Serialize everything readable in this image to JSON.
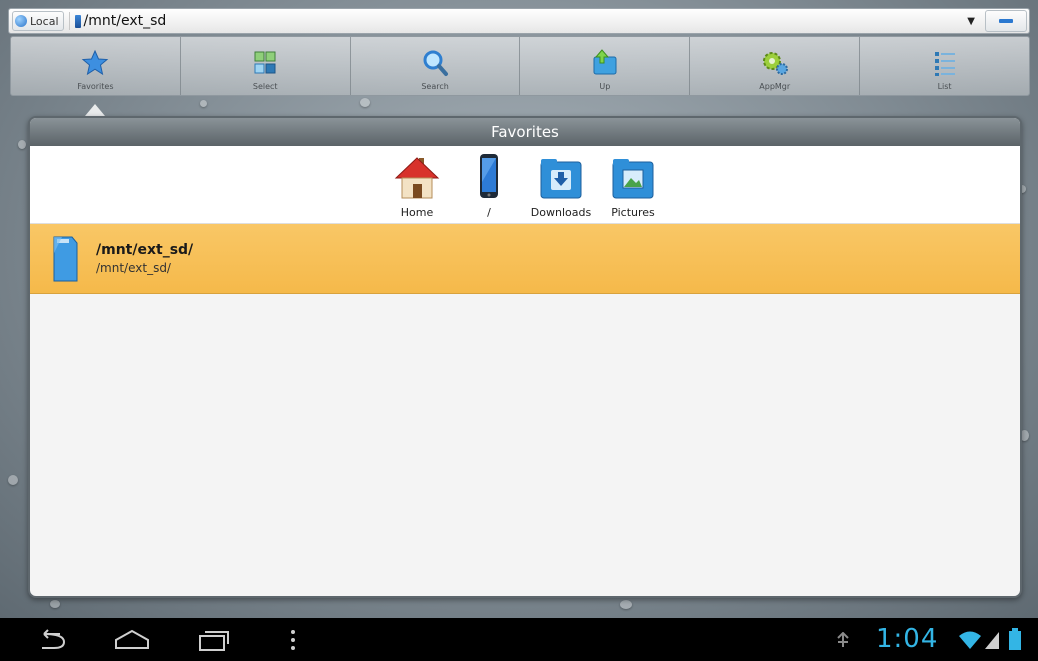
{
  "address_bar": {
    "storage_label": "Local",
    "path": "/mnt/ext_sd"
  },
  "toolbar": {
    "items": [
      {
        "label": "Favorites",
        "icon": "star-icon"
      },
      {
        "label": "Select",
        "icon": "select-grid-icon"
      },
      {
        "label": "Search",
        "icon": "magnifier-icon"
      },
      {
        "label": "Up",
        "icon": "folder-up-icon"
      },
      {
        "label": "AppMgr",
        "icon": "gears-icon"
      },
      {
        "label": "List",
        "icon": "list-view-icon"
      }
    ]
  },
  "dialog": {
    "title": "Favorites",
    "shortcuts": [
      {
        "label": "Home",
        "icon": "house-icon"
      },
      {
        "label": "/",
        "icon": "phone-icon"
      },
      {
        "label": "Downloads",
        "icon": "downloads-folder-icon"
      },
      {
        "label": "Pictures",
        "icon": "pictures-folder-icon"
      }
    ],
    "items": [
      {
        "title": "/mnt/ext_sd/",
        "subtitle": "/mnt/ext_sd/",
        "icon": "sd-card-icon"
      }
    ]
  },
  "navbar": {
    "time": "1:04"
  },
  "colors": {
    "accent_blue": "#33b5e5",
    "selected_row": "#f5b94a",
    "dialog_title_bg": "#6f777c"
  }
}
